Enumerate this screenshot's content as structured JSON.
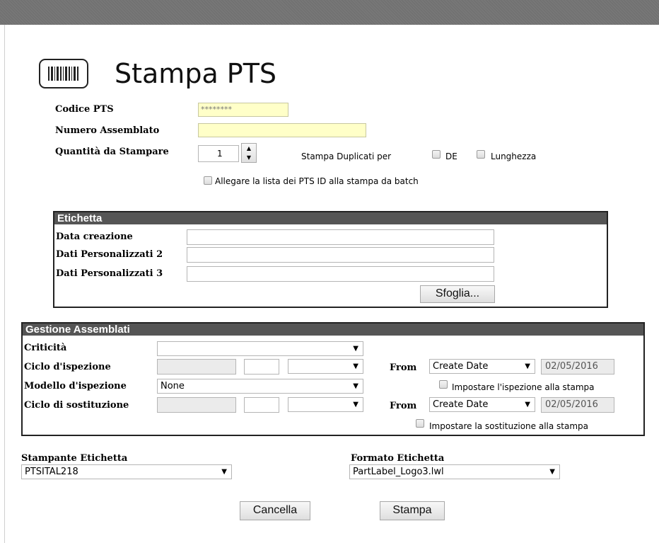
{
  "page": {
    "title": "Stampa PTS"
  },
  "form": {
    "codice_pts_label": "Codice PTS",
    "codice_pts_value": "********",
    "numero_assemblato_label": "Numero Assemblato",
    "numero_assemblato_value": "",
    "quantita_label": "Quantità da Stampare",
    "quantita_value": "1",
    "stampa_duplicati_label": "Stampa Duplicati per",
    "de_label": "DE",
    "lunghezza_label": "Lunghezza",
    "allegare_label": "Allegare la lista dei PTS ID alla stampa da batch"
  },
  "etichetta": {
    "header": "Etichetta",
    "data_creazione_label": "Data creazione",
    "dati_pers2_label": "Dati  Personalizzati 2",
    "dati_pers3_label": "Dati  Personalizzati 3",
    "sfoglia_label": "Sfoglia..."
  },
  "gestione": {
    "header": "Gestione Assemblati",
    "criticita_label": "Criticità",
    "criticita_value": "",
    "ciclo_ispezione_label": "Ciclo d'ispezione",
    "modello_ispezione_label": "Modello d'ispezione",
    "modello_ispezione_value": "None",
    "ciclo_sostituzione_label": "Ciclo di sostituzione",
    "from_label": "From",
    "from_select_value": "Create Date",
    "date_value": "02/05/2016",
    "impostare_ispezione_label": "Impostare l'ispezione alla stampa",
    "impostare_sostituzione_label": "Impostare la sostituzione alla stampa"
  },
  "stampante": {
    "label": "Stampante Etichetta",
    "value": "PTSITAL218"
  },
  "formato": {
    "label": "Formato Etichetta",
    "value": "PartLabel_Logo3.lwl"
  },
  "buttons": {
    "cancella": "Cancella",
    "stampa": "Stampa"
  },
  "icons": {
    "title_icon": "barcode-icon",
    "dropdown": "dropdown-arrow-icon",
    "arrow_glyph": "▼"
  }
}
